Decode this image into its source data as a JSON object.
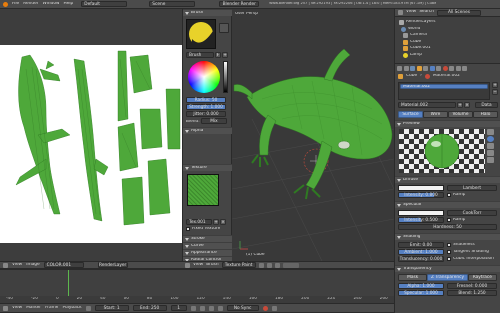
{
  "topbar": {
    "menus": [
      "File",
      "Render",
      "Window",
      "Help"
    ],
    "layout": "Default",
    "scene": "Scene",
    "engine": "Blender Render",
    "info": "www.blender.org 257 | Ve:292193 | Fa:292206 | Ob:1-4 | La:0 | Mem:183.97M (67.1M) | Cube"
  },
  "uv_editor": {
    "header": [
      "View",
      "Image"
    ],
    "image_name": "COLOR.001",
    "render_layer": "RenderLayer"
  },
  "tool_panel": {
    "brush_title": "Brush",
    "brush_name": "Brush",
    "radius": "Radius: 50",
    "strength": "Strength: 1.000",
    "jitter": "Jitter: 0.000",
    "blend_label": "Blend:",
    "blend_value": "Mix",
    "alpha": "Alpha",
    "texture": "Texture",
    "tex_name": "Tex.001",
    "fixed_texture": "Fixed Texture",
    "stroke": "Stroke",
    "curve": "Curve",
    "appearance": "Appearance",
    "radial": "Radial Control"
  },
  "viewport": {
    "label": "User Persp",
    "object_label": "(1) Cube",
    "header": [
      "View",
      "Brush"
    ],
    "mode": "Texture Paint"
  },
  "outliner": {
    "tabs": [
      "View",
      "Search",
      "All Scenes"
    ],
    "items": [
      "RenderLayers",
      "World",
      "Camera",
      "Cube",
      "Cube.001",
      "Lamp"
    ]
  },
  "properties": {
    "breadcrumb": [
      "Cube",
      "Material.002"
    ],
    "material_slot": "Material.002",
    "material_name": "Material.002",
    "data_label": "Data",
    "tabs": [
      "Surface",
      "Wire",
      "Volume",
      "Halo"
    ],
    "preview": "Preview",
    "diffuse": "Diffuse",
    "diffuse_shader": "Lambert",
    "intensity_diff": "Intensity: 0.800",
    "ramp": "Ramp",
    "specular": "Specular",
    "spec_shader": "CookTorr",
    "intensity_spec": "Intensity: 0.500",
    "hardness": "Hardness: 50",
    "shading": "Shading",
    "emit": "Emit: 0.00",
    "ambient": "Ambient: 1.000",
    "translucency": "Translucency: 0.000",
    "shadeless": "Shadeless",
    "tangent": "Tangent Shading",
    "cubic": "Cubic Interpolation",
    "transparency": "Transparency",
    "trans_modes": [
      "Mask",
      "Z Transparency",
      "Raytrace"
    ],
    "alpha_val": "Alpha: 1.000",
    "fresnel": "Fresnel: 0.000",
    "specular_t": "Specular: 1.000",
    "blend_t": "Blend: 1.250"
  },
  "timeline": {
    "ruler": [
      "-40",
      "-20",
      "0",
      "20",
      "40",
      "60",
      "80",
      "100",
      "120",
      "140",
      "160",
      "180",
      "200",
      "220",
      "240",
      "260"
    ],
    "menus": [
      "View",
      "Marker",
      "Frame",
      "Playback"
    ],
    "start": "Start: 1",
    "end": "End: 250",
    "current": "1",
    "sync": "No Sync"
  },
  "colors": {
    "accent": "#5680c2",
    "mesh_green": "#4ea83a",
    "header_gray": "#4b4b4b"
  }
}
